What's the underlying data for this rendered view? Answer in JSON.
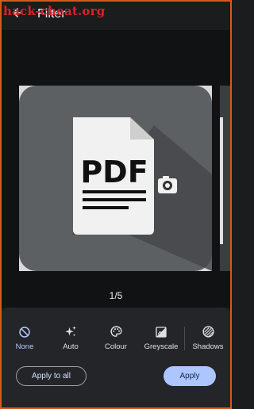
{
  "watermark": "hack-cheat.org",
  "appbar": {
    "title": "Filter",
    "back_icon": "arrow-left-icon"
  },
  "preview": {
    "page_counter": "1/5",
    "document_label": "PDF"
  },
  "filters": [
    {
      "label": "None",
      "icon": "none-icon",
      "selected": true
    },
    {
      "label": "Auto",
      "icon": "sparkle-icon",
      "selected": false
    },
    {
      "label": "Colour",
      "icon": "palette-icon",
      "selected": false
    },
    {
      "label": "Greyscale",
      "icon": "greyscale-icon",
      "selected": false
    },
    {
      "label": "Shadows",
      "icon": "shadows-icon",
      "selected": false
    }
  ],
  "actions": {
    "apply_all_label": "Apply to all",
    "apply_label": "Apply"
  },
  "colors": {
    "accent": "#aec6ff",
    "frame": "#d35b1e",
    "watermark": "#d8232a"
  }
}
